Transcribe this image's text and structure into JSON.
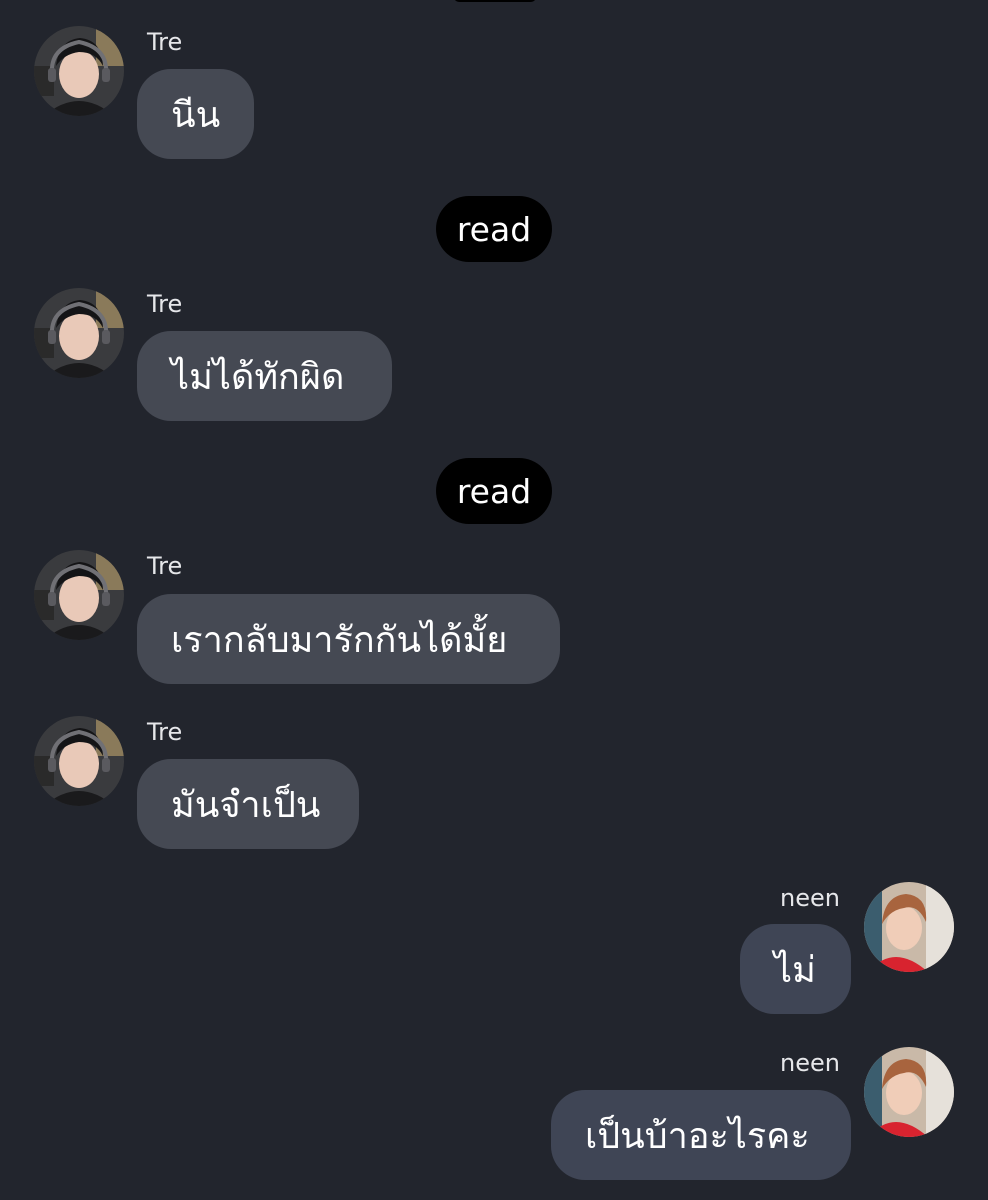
{
  "conversation": {
    "messages": [
      {
        "sender": "Tre",
        "text": "นีน"
      },
      {
        "status": "read"
      },
      {
        "sender": "Tre",
        "text": "ไม่ได้ทักผิด"
      },
      {
        "status": "read"
      },
      {
        "sender": "Tre",
        "text": "เรากลับมารักกันได้มั้ย"
      },
      {
        "sender": "Tre",
        "text": "มันจำเป็น"
      },
      {
        "sender": "neen",
        "text": "ไม่"
      },
      {
        "sender": "neen",
        "text": "เป็นบ้าอะไรคะ"
      }
    ]
  },
  "colors": {
    "background": "#22252d",
    "incoming_bubble": "#454953",
    "outgoing_bubble": "#3f4555",
    "read_pill": "#000000"
  },
  "icons": {
    "tre_avatar": "profile-photo-tre",
    "neen_avatar": "profile-photo-neen"
  }
}
